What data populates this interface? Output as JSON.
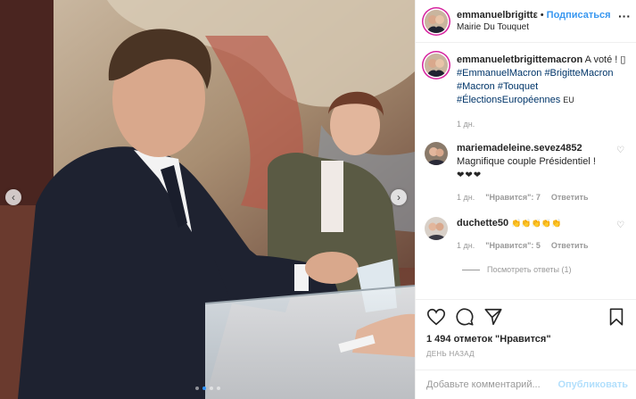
{
  "post": {
    "header": {
      "username": "emmanuelbrigittε",
      "separator": "•",
      "follow_label": "Подписаться",
      "location": "Mairie Du Touquet",
      "more_icon": "more-horizontal-icon"
    },
    "caption": {
      "username": "emmanueletbrigittemacron",
      "text": "A voté ! ▯",
      "hashtags": [
        "#EmmanuelMacron",
        "#BrigitteMacron",
        "#Macron",
        "#Touquet",
        "#ÉlectionsEuropéennes"
      ],
      "suffix": "EU",
      "time": "1 дн."
    },
    "comments": [
      {
        "username": "mariemadeleine.sevez4852",
        "text": "Magnifique couple Présidentiel !",
        "hearts": "❤❤❤",
        "time": "1 дн.",
        "likes_label": "\"Нравится\": 7",
        "reply_label": "Ответить"
      },
      {
        "username": "duchette50",
        "text": "👏👏👏👏👏",
        "time": "1 дн.",
        "likes_label": "\"Нравится\": 5",
        "reply_label": "Ответить",
        "view_replies_label": "Посмотреть ответы (1)"
      }
    ],
    "actions": {
      "like_icon": "heart-icon",
      "comment_icon": "comment-icon",
      "share_icon": "share-icon",
      "save_icon": "bookmark-icon"
    },
    "likes_text": "1 494 отметок \"Нравится\"",
    "date_text": "ДЕНЬ НАЗАД",
    "add_comment": {
      "placeholder": "Добавьте комментарий...",
      "publish_label": "Опубликовать"
    },
    "carousel": {
      "prev_icon": "chevron-left-icon",
      "next_icon": "chevron-right-icon",
      "slides": 4,
      "active_slide": 1
    },
    "colors": {
      "follow_blue": "#3897f0",
      "hashtag_blue": "#003569",
      "story_ring": "#d6249f",
      "publish_disabled": "#b2dffc"
    }
  }
}
